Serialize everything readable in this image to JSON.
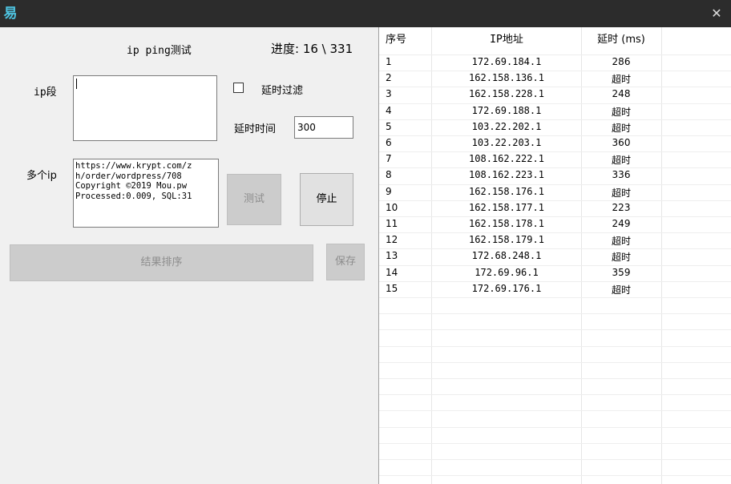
{
  "window": {
    "icon": "易",
    "close_glyph": "✕"
  },
  "left": {
    "ping_title": "ip ping测试",
    "progress": "进度: 16 \\ 331",
    "ip_segment_label": "ip段",
    "ip_segment_value": "",
    "delay_filter_label": "延时过滤",
    "delay_time_label": "延时时间",
    "delay_time_value": "300",
    "multi_ip_label": "多个ip",
    "multi_ip_lines": [
      "https://www.krypt.com/z",
      "h/order/wordpress/708",
      "Copyright ©2019 Mou.pw",
      "Processed:0.009, SQL:31"
    ],
    "test_button": "测试",
    "stop_button": "停止",
    "sort_button": "结果排序",
    "save_button": "保存"
  },
  "table": {
    "headers": [
      "序号",
      "IP地址",
      "延时 (ms)"
    ],
    "rows": [
      [
        "1",
        "172.69.184.1",
        "286"
      ],
      [
        "2",
        "162.158.136.1",
        "超时"
      ],
      [
        "3",
        "162.158.228.1",
        "248"
      ],
      [
        "4",
        "172.69.188.1",
        "超时"
      ],
      [
        "5",
        "103.22.202.1",
        "超时"
      ],
      [
        "6",
        "103.22.203.1",
        "360"
      ],
      [
        "7",
        "108.162.222.1",
        "超时"
      ],
      [
        "8",
        "108.162.223.1",
        "336"
      ],
      [
        "9",
        "162.158.176.1",
        "超时"
      ],
      [
        "10",
        "162.158.177.1",
        "223"
      ],
      [
        "11",
        "162.158.178.1",
        "249"
      ],
      [
        "12",
        "162.158.179.1",
        "超时"
      ],
      [
        "13",
        "172.68.248.1",
        "超时"
      ],
      [
        "14",
        "172.69.96.1",
        "359"
      ],
      [
        "15",
        "172.69.176.1",
        "超时"
      ]
    ]
  }
}
